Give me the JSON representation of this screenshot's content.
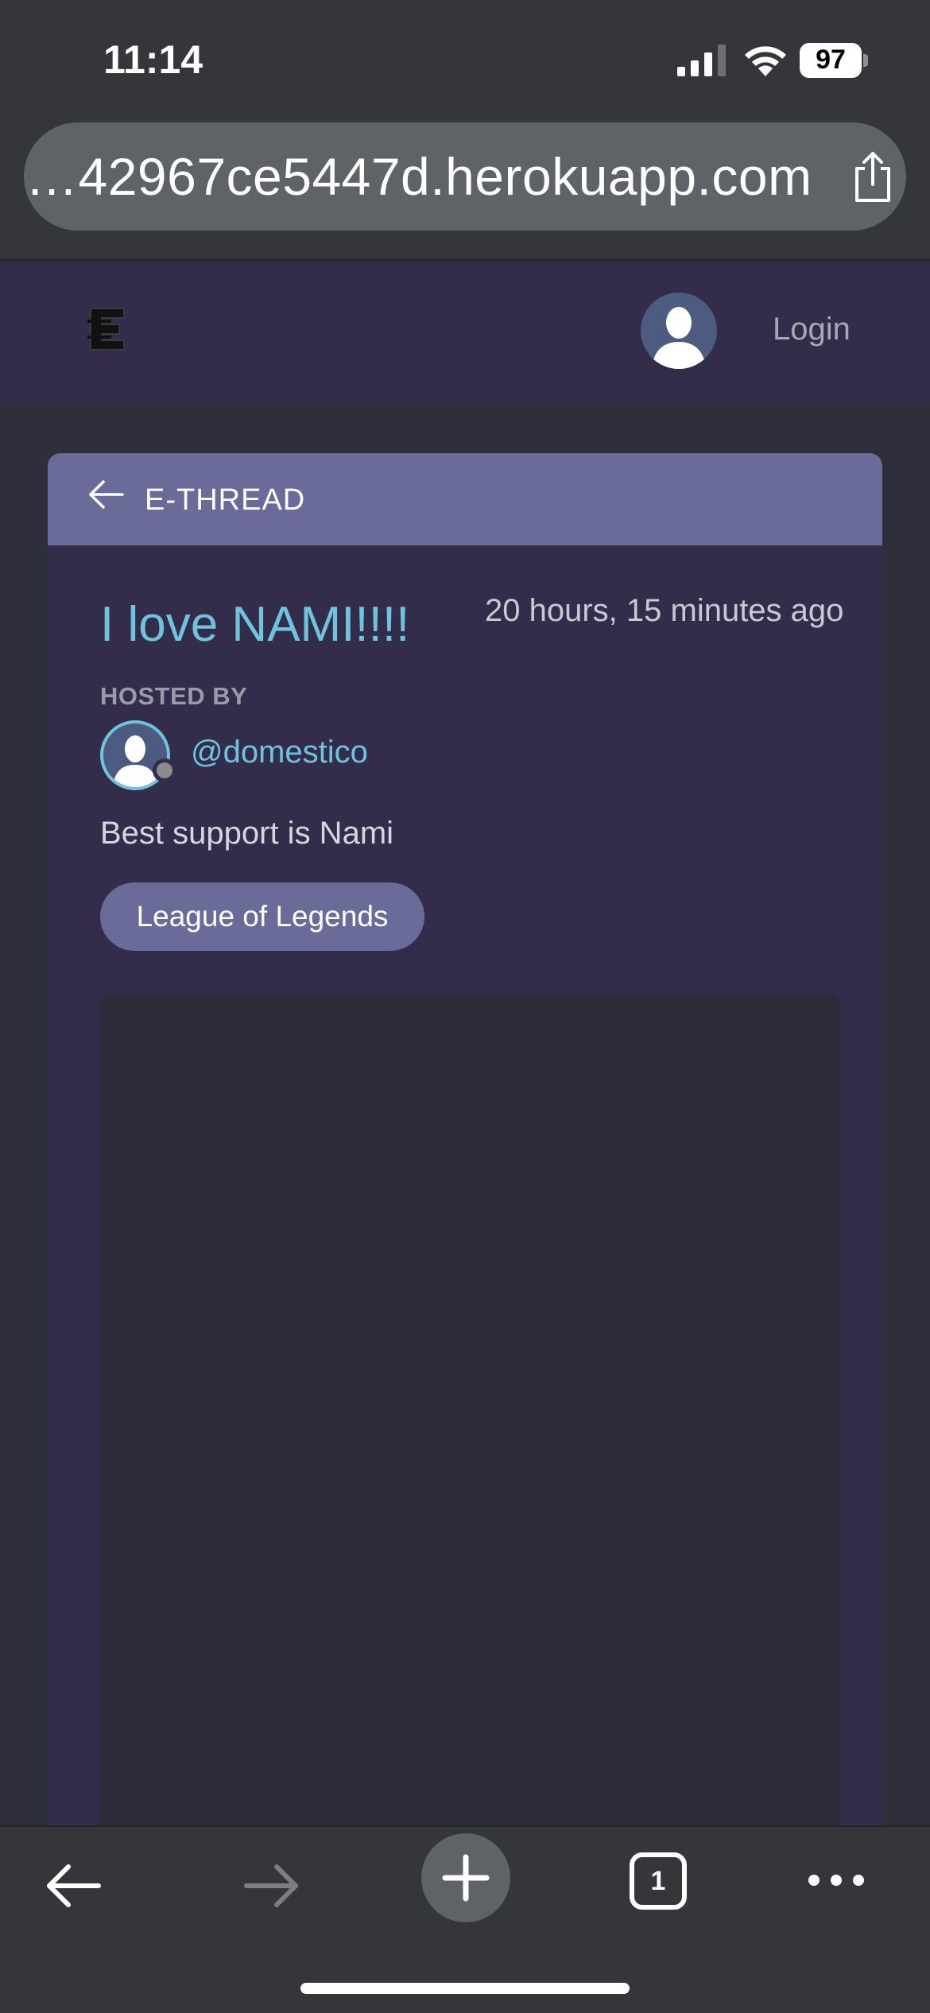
{
  "status_bar": {
    "time": "11:14",
    "battery_level": "97"
  },
  "browser": {
    "url": "…42967ce5447d.herokuapp.com",
    "open_tabs_count": "1"
  },
  "nav": {
    "login_label": "Login"
  },
  "card": {
    "header_title": "E-THREAD",
    "thread_title": "I love NAMI!!!!",
    "time_ago": "20 hours, 15 minutes ago",
    "hosted_by_label": "HOSTED BY",
    "host_username": "@domestico",
    "description": "Best support is Nami",
    "topic_tag": "League of Legends"
  },
  "colors": {
    "accent_cyan": "#6fc3dc",
    "header_purple": "#6b6b9a",
    "card_bg": "#332d4b"
  }
}
